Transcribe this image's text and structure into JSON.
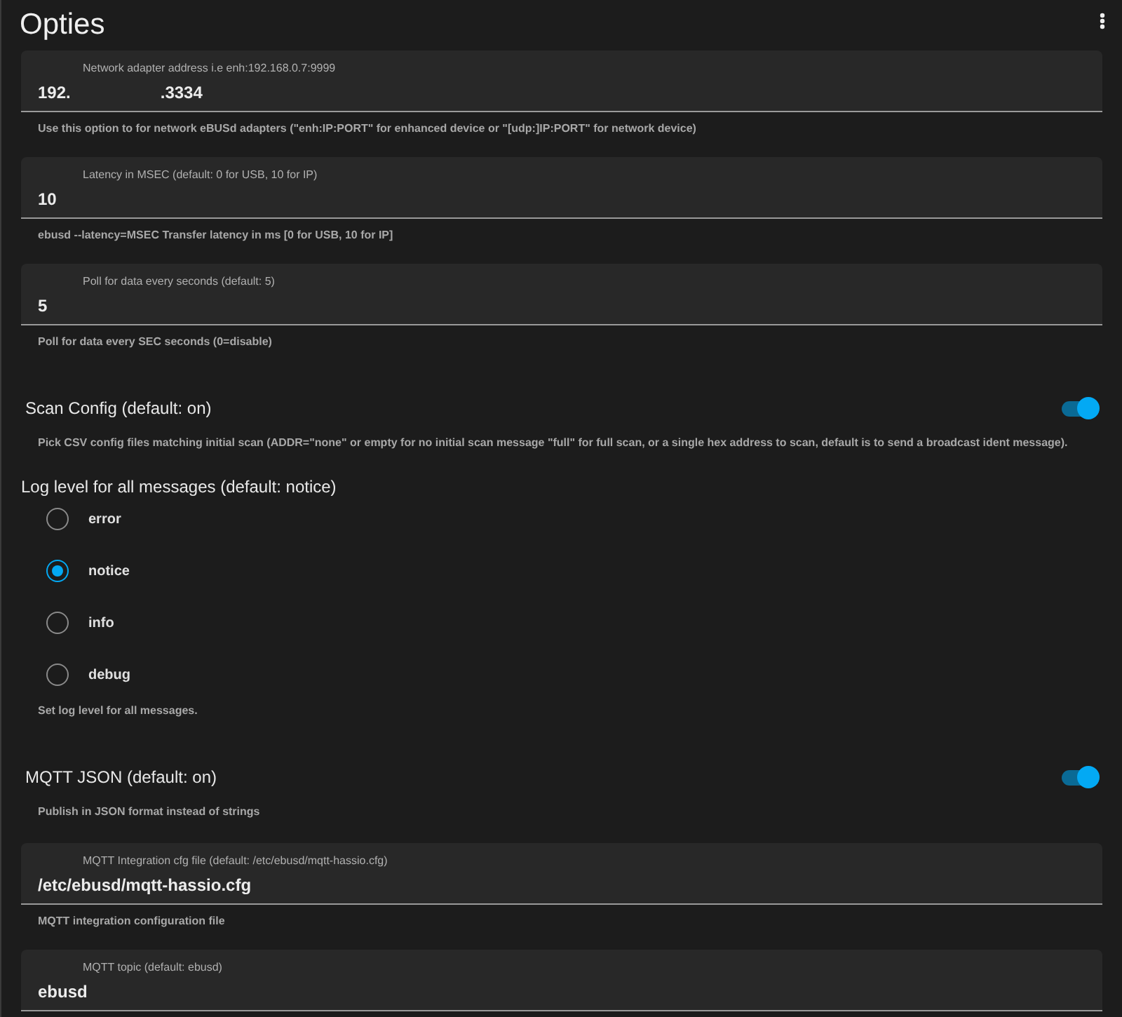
{
  "title": "Opties",
  "items": [
    {
      "kind": "field",
      "label": "Network adapter address i.e enh:192.168.0.7:9999",
      "value": "192.",
      "value_end": ".3334",
      "helper": "Use this option to for network eBUSd adapters (\"enh:IP:PORT\" for enhanced device or \"[udp:]IP:PORT\" for network device)"
    },
    {
      "kind": "field",
      "label": "Latency in MSEC (default: 0 for USB, 10 for IP)",
      "value": "10",
      "helper": "ebusd --latency=MSEC Transfer latency in ms [0 for USB, 10 for IP]"
    },
    {
      "kind": "field",
      "label": "Poll for data every seconds (default: 5)",
      "value": "5",
      "helper": "Poll for data every SEC seconds (0=disable)"
    },
    {
      "kind": "toggle",
      "label": "Scan Config (default: on)",
      "on": true,
      "helper": "Pick CSV config files matching initial scan (ADDR=\"none\" or empty for no initial scan message \"full\" for full scan, or a single hex address to scan, default is to send a broadcast ident message)."
    },
    {
      "kind": "radio_group",
      "label": "Log level for all messages (default: notice)",
      "options": [
        {
          "label": "error",
          "selected": false
        },
        {
          "label": "notice",
          "selected": true
        },
        {
          "label": "info",
          "selected": false
        },
        {
          "label": "debug",
          "selected": false
        }
      ],
      "helper": "Set log level for all messages."
    },
    {
      "kind": "toggle",
      "label": "MQTT JSON (default: on)",
      "on": true,
      "helper": "Publish in JSON format instead of strings"
    },
    {
      "kind": "field",
      "label": "MQTT Integration cfg file (default: /etc/ebusd/mqtt-hassio.cfg)",
      "value": "/etc/ebusd/mqtt-hassio.cfg",
      "helper": "MQTT integration configuration file"
    },
    {
      "kind": "field",
      "label": "MQTT topic (default: ebusd)",
      "value": "ebusd"
    }
  ]
}
